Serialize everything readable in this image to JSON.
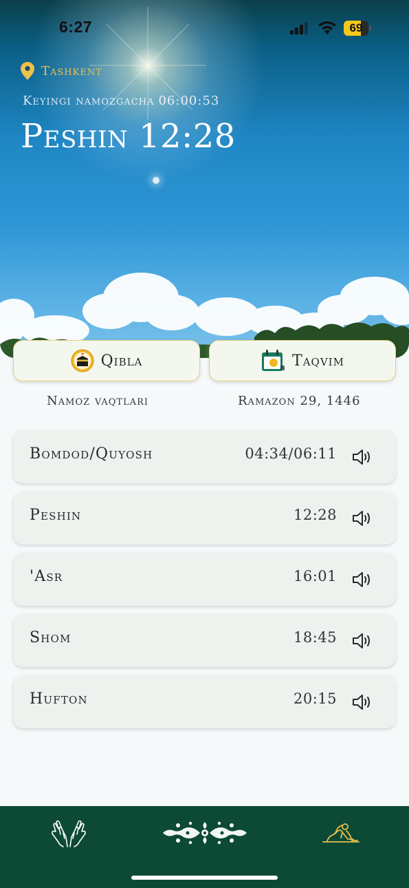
{
  "status_bar": {
    "time": "6:27",
    "battery": "69",
    "battery_level": 0.69
  },
  "header": {
    "location": "Tashkent",
    "countdown_label": "Keyingi namozgacha",
    "countdown_value": "06:00:53",
    "current_prayer": "Peshin 12:28"
  },
  "quick_actions": {
    "qibla_label": "Qibla",
    "taqvim_label": "Taqvim"
  },
  "sub_labels": {
    "left": "Namoz vaqtlari",
    "right": "Ramazon 29, 1446"
  },
  "prayers": [
    {
      "name": "Bomdod/Quyosh",
      "time": "04:34/06:11"
    },
    {
      "name": "Peshin",
      "time": "12:28"
    },
    {
      "name": "'Asr",
      "time": "16:01"
    },
    {
      "name": "Shom",
      "time": "18:45"
    },
    {
      "name": "Hufton",
      "time": "20:15"
    }
  ],
  "colors": {
    "accent_gold": "#f0c14b",
    "nav_green": "#0d4a36",
    "card_bg": "#eef1ee",
    "background": "#f6f9fa"
  },
  "icons": {
    "location": "location-pin-icon",
    "qibla": "kaaba-icon",
    "taqvim": "calendar-icon",
    "speaker": "speaker-icon",
    "nav_dua": "praying-hands-icon",
    "nav_home": "ornament-icon",
    "nav_namaz": "prostration-icon"
  }
}
